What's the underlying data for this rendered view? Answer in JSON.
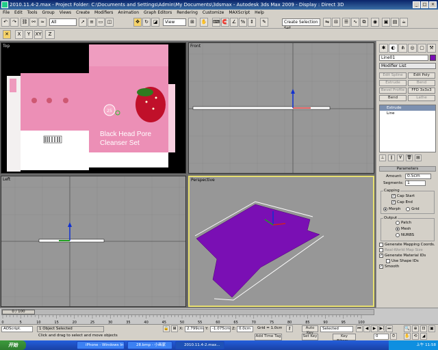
{
  "window": {
    "title": "2010.11.4-2.max   - Project Folder: C:\\Documents and Settings\\Admin\\My Documents\\3dsmax   - Autodesk 3ds Max  2009      - Display : Direct 3D"
  },
  "menu": [
    "File",
    "Edit",
    "Tools",
    "Group",
    "Views",
    "Create",
    "Modifiers",
    "Animation",
    "Graph Editors",
    "Rendering",
    "Customize",
    "MAXScript",
    "Help"
  ],
  "toolbar": {
    "selection_filter": "All",
    "ref_coord": "View",
    "named_selection": "Create Selection Set"
  },
  "axis_constraints": [
    "X",
    "Y",
    "Z",
    "XY",
    "XY"
  ],
  "viewports": {
    "top": "Top",
    "front": "Front",
    "left": "Left",
    "perspective": "Perspective"
  },
  "box_texture": {
    "title_line1": "Black Head Pore",
    "title_line2": "Cleanser Set",
    "badge": "25"
  },
  "command_panel": {
    "object_name": "Line01",
    "modifier_list": "Modifier List",
    "buttons": [
      "Edit Spline",
      "Edit Poly",
      "Extrude",
      "Bend",
      "Bevel Profile",
      "FFD 3x3x3",
      "Bend",
      "Lathe"
    ],
    "stack": [
      "Extrude",
      "Line"
    ],
    "rollout_title": "Parameters",
    "amount_label": "Amount:",
    "amount_value": "0.5cm",
    "segments_label": "Segments:",
    "segments_value": "1",
    "capping_title": "Capping",
    "cap_start": "Cap Start",
    "cap_end": "Cap End",
    "morph": "Morph",
    "grid": "Grid",
    "output_title": "Output",
    "output_patch": "Patch",
    "output_mesh": "Mesh",
    "output_nurbs": "NURBS",
    "gen_mapping": "Generate Mapping Coords.",
    "real_world": "Real-World Map Size",
    "gen_mat_ids": "Generate Material IDs",
    "use_shape_ids": "Use Shape IDs",
    "smooth": "Smooth"
  },
  "timeline": {
    "frame_counter": "0 / 100",
    "ticks": [
      "0",
      "5",
      "10",
      "15",
      "20",
      "25",
      "30",
      "35",
      "40",
      "45",
      "50",
      "55",
      "60",
      "65",
      "70",
      "75",
      "80",
      "85",
      "90",
      "95",
      "100"
    ]
  },
  "status": {
    "script_listener": "AOScript.",
    "selection": "1 Object Selected",
    "prompt": "Click and drag to select and move objects",
    "x_label": "X:",
    "x_value": "2.799cm",
    "y_label": "Y:",
    "y_value": "-1.075cm",
    "z_label": "Z:",
    "z_value": "0.0cm",
    "grid": "Grid = 1.0cm",
    "add_time_tag": "Add Time Tag",
    "auto_key": "Auto Key",
    "set_key": "Set Key",
    "selected": "Selected",
    "key_filters": "Key Filters...",
    "frame": "0"
  },
  "taskbar": {
    "start": "开始",
    "tasks": [
      "iPhone - Windows Int...",
      "28.bmp - 小画家",
      "2010.11.4-2.max..."
    ],
    "clock": "上午 11:58"
  },
  "colors": {
    "viewport_bg": "#979797",
    "purple_mesh": "#7a0fb4",
    "box_pink": "#ec8fb6",
    "active_border": "#e8e070",
    "title_blue": "#0a246a"
  }
}
